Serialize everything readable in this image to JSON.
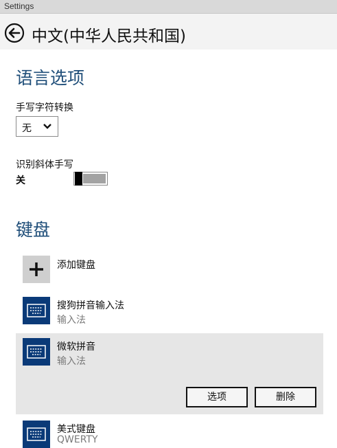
{
  "window": {
    "title": "Settings"
  },
  "header": {
    "title": "中文(中华人民共和国)"
  },
  "language_options": {
    "title": "语言选项",
    "handwriting_conversion": {
      "label": "手写字符转换",
      "selected": "无"
    },
    "italic_recognition": {
      "label": "识别斜体手写",
      "state_label": "关",
      "enabled": false
    }
  },
  "keyboards": {
    "title": "键盘",
    "add_label": "添加键盘",
    "items": [
      {
        "name": "搜狗拼音输入法",
        "type": "输入法"
      },
      {
        "name": "微软拼音",
        "type": "输入法",
        "selected": true
      },
      {
        "name": "美式键盘",
        "type": "QWERTY"
      }
    ],
    "actions": {
      "options_label": "选项",
      "delete_label": "删除"
    }
  },
  "colors": {
    "accent": "#1f4e79",
    "tile": "#0a3a78",
    "selected_bg": "#e6e6e6"
  }
}
